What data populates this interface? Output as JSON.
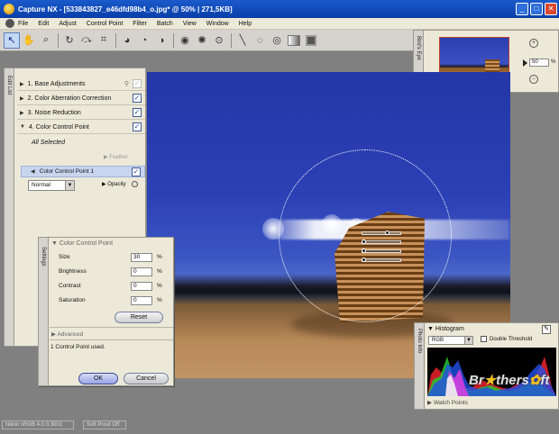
{
  "window": {
    "title": "Capture NX - [533843827_e46dfd98b4_o.jpg* @ 50% | 271,5KB]",
    "controls": [
      "minimize",
      "maximize",
      "close"
    ]
  },
  "menu": [
    "File",
    "Edit",
    "Adjust",
    "Control Point",
    "Filter",
    "Batch",
    "View",
    "Window",
    "Help"
  ],
  "toolbar": {
    "tools": [
      "direct-select",
      "hand",
      "zoom",
      "rotate",
      "straighten",
      "crop",
      "black-point",
      "white-point",
      "neutral-point",
      "red-eye",
      "auto-retouch",
      "color-control-point",
      "lasso",
      "marquee",
      "gradient",
      "fill"
    ]
  },
  "birds_eye": {
    "tab_label": "Bird's Eye",
    "zoom_value": "50",
    "zoom_unit": "%"
  },
  "edit_list": {
    "tab_label": "Edit List",
    "steps": [
      {
        "label": "1. Base Adjustments",
        "checked": false
      },
      {
        "label": "2. Color Aberration Correction",
        "checked": true
      },
      {
        "label": "3. Noise Reduction",
        "checked": true
      },
      {
        "label": "4. Color Control Point",
        "checked": true
      }
    ],
    "selection": "All Selected",
    "feather_label": "Feather",
    "control_point_label": "Color Control Point 1",
    "blend_mode": "Normal",
    "opacity_label": "Opacity"
  },
  "settings": {
    "tab_label": "Settings",
    "header": "Color Control Point",
    "params": [
      {
        "label": "Size",
        "value": "30",
        "unit": "%"
      },
      {
        "label": "Brightness",
        "value": "0",
        "unit": "%"
      },
      {
        "label": "Contrast",
        "value": "0",
        "unit": "%"
      },
      {
        "label": "Saturation",
        "value": "0",
        "unit": "%"
      }
    ],
    "reset_label": "Reset",
    "advanced_label": "Advanced",
    "status_text": "1 Control Point used.",
    "ok_label": "OK",
    "cancel_label": "Cancel"
  },
  "histogram": {
    "tab_label": "Photo Info",
    "header": "Histogram",
    "channel": "RGB",
    "double_threshold_label": "Double Threshold",
    "watch_points_label": "Watch Points"
  },
  "watermark": {
    "text_left": "Br",
    "text_mid": "thers",
    "text_right": "ft"
  },
  "statusbar": {
    "profile": "Nikon sRGB 4.0.0.3001",
    "soft_proof": "Soft Proof Off"
  },
  "colors": {
    "titlebar": "#0a3ea8",
    "panel_bg": "#ece9d8",
    "workspace_bg": "#808080",
    "selection_bg": "#c9d5ef"
  }
}
